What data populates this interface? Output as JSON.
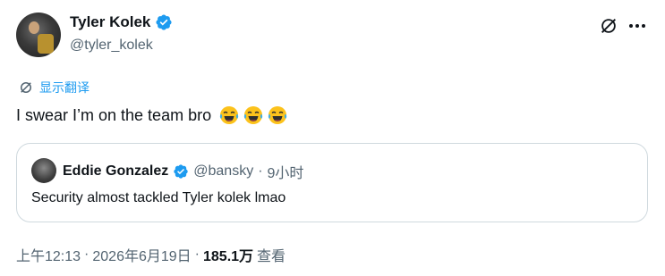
{
  "author": {
    "name": "Tyler Kolek",
    "handle": "@tyler_kolek"
  },
  "translate_label": "显示翻译",
  "tweet": {
    "text": "I swear I’m on the team bro",
    "emojis": [
      "face-with-tears-of-joy",
      "face-with-tears-of-joy",
      "face-with-tears-of-joy"
    ]
  },
  "quote": {
    "name": "Eddie Gonzalez",
    "handle": "@bansky",
    "dot": "·",
    "time": "9小时",
    "text": "Security almost tackled Tyler kolek lmao"
  },
  "meta": {
    "time": "上午12:13",
    "sep1": "·",
    "date": "2026年6月19日",
    "sep2": "·",
    "views_count": "185.1万",
    "views_label": "查看"
  },
  "icons": {
    "verified": "verified-badge-icon",
    "grok": "grok-icon",
    "more": "more-icon",
    "translate": "translate-icon"
  },
  "colors": {
    "accent": "#1d9bf0",
    "secondary_text": "#536471",
    "primary_text": "#0f1419",
    "border": "#cfd9de"
  }
}
